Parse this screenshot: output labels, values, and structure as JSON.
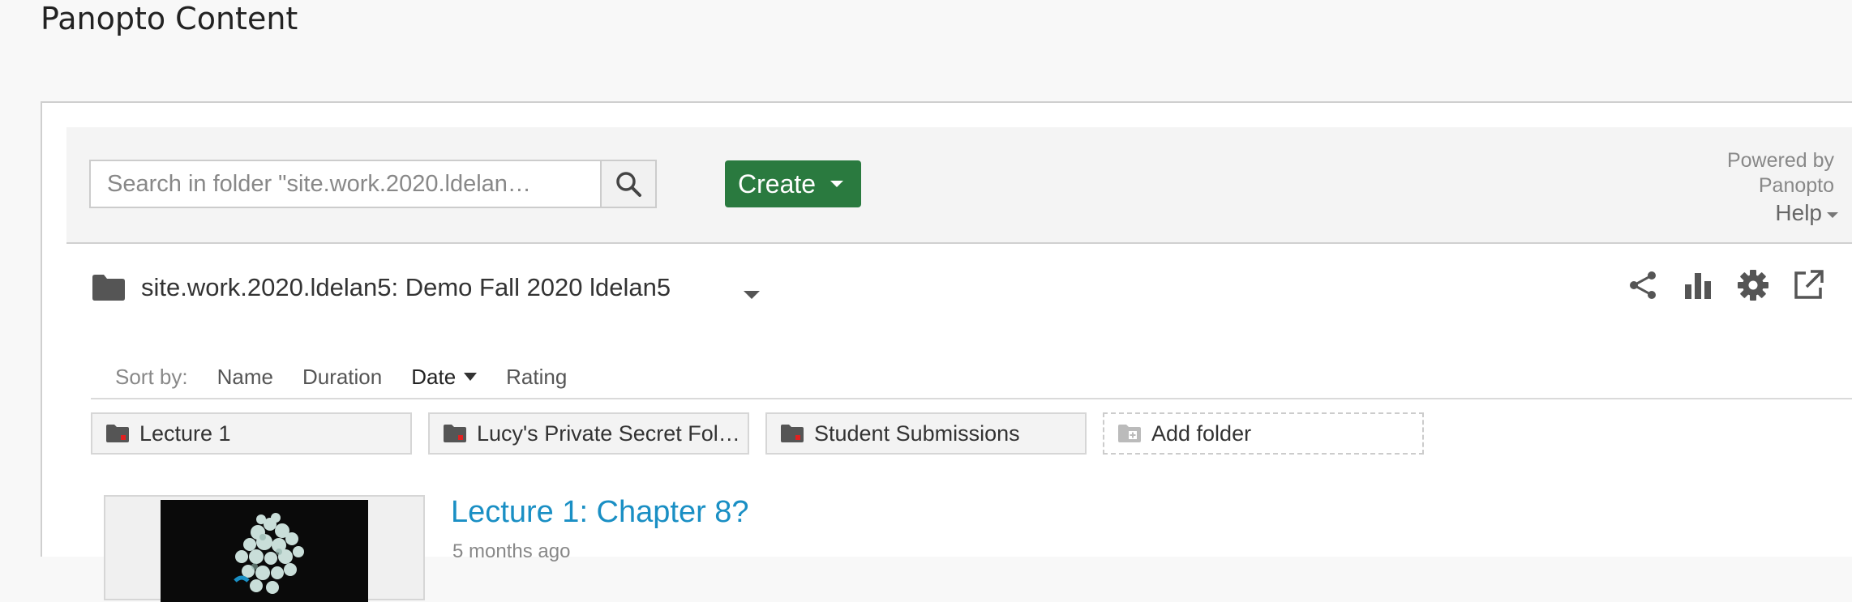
{
  "page": {
    "title": "Panopto Content"
  },
  "toolbar": {
    "search_placeholder": "Search in folder \"site.work.2020.ldelan…",
    "create_label": "Create",
    "powered_line1": "Powered by",
    "powered_line2": "Panopto",
    "help_label": "Help"
  },
  "folder": {
    "name": "site.work.2020.ldelan5: Demo Fall 2020 ldelan5"
  },
  "actions": [
    "share-icon",
    "stats-icon",
    "settings-icon",
    "external-link-icon"
  ],
  "sort": {
    "label": "Sort by:",
    "options": [
      "Name",
      "Duration",
      "Date",
      "Rating"
    ],
    "active": "Date"
  },
  "subfolders": [
    {
      "name": "Lecture 1"
    },
    {
      "name": "Lucy's Private Secret Fol…"
    },
    {
      "name": "Student Submissions"
    }
  ],
  "add_folder_label": "Add folder",
  "sessions": [
    {
      "title": "Lecture 1: Chapter 8?",
      "meta": "5 months ago"
    }
  ],
  "colors": {
    "create_bg": "#2a7a3f",
    "link": "#1a8fc4",
    "folder_icon": "#555555",
    "folder_badge": "#e02020"
  }
}
